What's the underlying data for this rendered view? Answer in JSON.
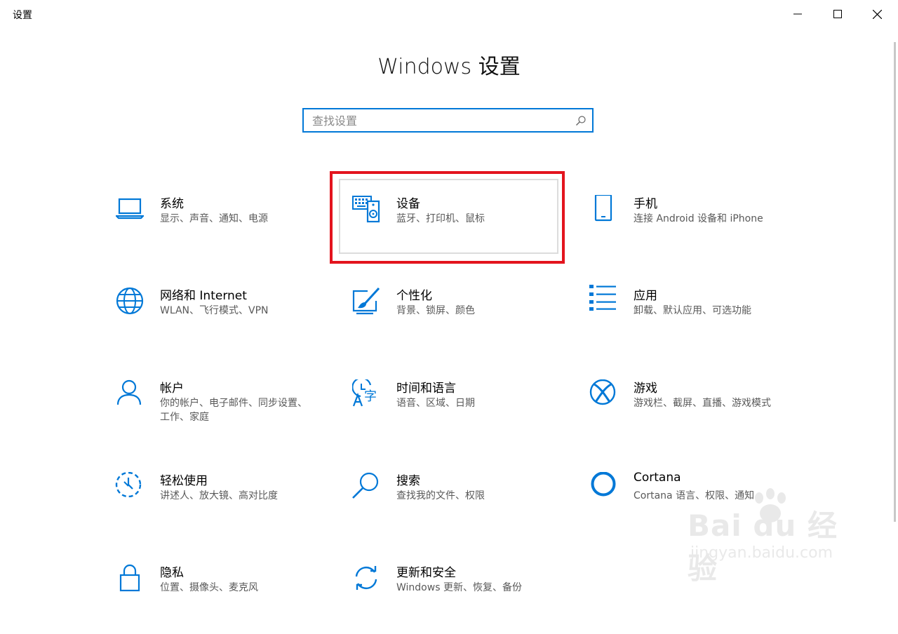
{
  "window": {
    "app_title": "设置",
    "minimize": "minimize-icon",
    "maximize": "maximize-icon",
    "close": "close-icon"
  },
  "heading": "Windows 设置",
  "search": {
    "placeholder": "查找设置",
    "value": "",
    "icon": "search-icon"
  },
  "colors": {
    "accent": "#0078d7",
    "highlight": "#e3141e",
    "subtitle": "#595959"
  },
  "tiles": [
    {
      "id": "system",
      "title": "系统",
      "subtitle": "显示、声音、通知、电源",
      "icon": "laptop-icon"
    },
    {
      "id": "devices",
      "title": "设备",
      "subtitle": "蓝牙、打印机、鼠标",
      "icon": "devices-icon"
    },
    {
      "id": "phone",
      "title": "手机",
      "subtitle": "连接 Android 设备和 iPhone",
      "icon": "phone-icon"
    },
    {
      "id": "network",
      "title": "网络和 Internet",
      "subtitle": "WLAN、飞行模式、VPN",
      "icon": "globe-icon"
    },
    {
      "id": "personalization",
      "title": "个性化",
      "subtitle": "背景、锁屏、颜色",
      "icon": "paint-icon"
    },
    {
      "id": "apps",
      "title": "应用",
      "subtitle": "卸载、默认应用、可选功能",
      "icon": "apps-list-icon"
    },
    {
      "id": "accounts",
      "title": "帐户",
      "subtitle": "你的帐户、电子邮件、同步设置、工作、家庭",
      "icon": "person-icon"
    },
    {
      "id": "time",
      "title": "时间和语言",
      "subtitle": "语音、区域、日期",
      "icon": "time-language-icon"
    },
    {
      "id": "gaming",
      "title": "游戏",
      "subtitle": "游戏栏、截屏、直播、游戏模式",
      "icon": "xbox-icon"
    },
    {
      "id": "ease",
      "title": "轻松使用",
      "subtitle": "讲述人、放大镜、高对比度",
      "icon": "ease-of-access-icon"
    },
    {
      "id": "search",
      "title": "搜索",
      "subtitle": "查找我的文件、权限",
      "icon": "magnifier-icon"
    },
    {
      "id": "cortana",
      "title": "Cortana",
      "subtitle": "Cortana 语言、权限、通知",
      "icon": "cortana-icon"
    },
    {
      "id": "privacy",
      "title": "隐私",
      "subtitle": "位置、摄像头、麦克风",
      "icon": "lock-icon"
    },
    {
      "id": "update",
      "title": "更新和安全",
      "subtitle": "Windows 更新、恢复、备份",
      "icon": "sync-icon"
    }
  ],
  "watermark": {
    "main": "Bai du 经验",
    "sub": "jingyan.baidu.com"
  }
}
